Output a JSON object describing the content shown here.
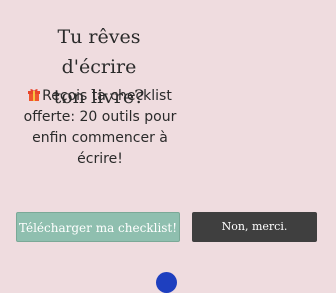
{
  "popup": {
    "title_line1": "Tu rêves d'écrire",
    "title_line2": "ton livre?",
    "offer_line1": "Reçois ta checklist",
    "offer_line2": "offerte: 20 outils pour",
    "offer_line3": "enfin commencer à",
    "offer_line4": "écrire!",
    "gift_icon": "gift-icon",
    "download_label": "Télécharger ma checklist!",
    "decline_label": "Non, merci."
  },
  "colors": {
    "background": "#efdcdf",
    "download_button": "#8fbfaf",
    "decline_button": "#3f3f3f",
    "bottom_dot": "#1e3fbf"
  }
}
